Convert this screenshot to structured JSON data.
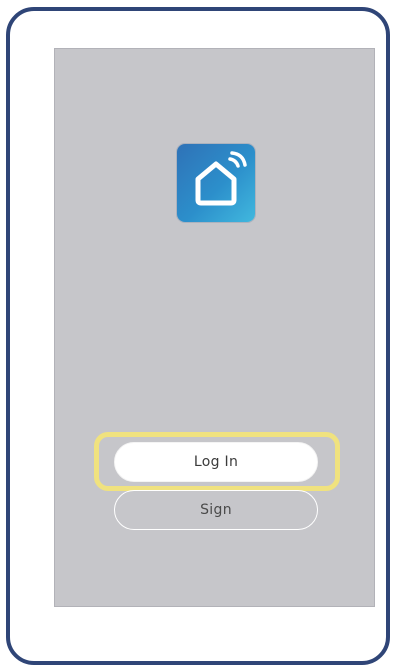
{
  "app": {
    "icon": "smart-home-icon",
    "icon_gradient": [
      "#2f72b7",
      "#41b8de"
    ]
  },
  "buttons": {
    "login_label": "Log In",
    "sign_label": "Sign"
  },
  "colors": {
    "device_frame": "#2f4577",
    "screen_background": "#c6c6ca",
    "highlight": "#f0e27f"
  }
}
